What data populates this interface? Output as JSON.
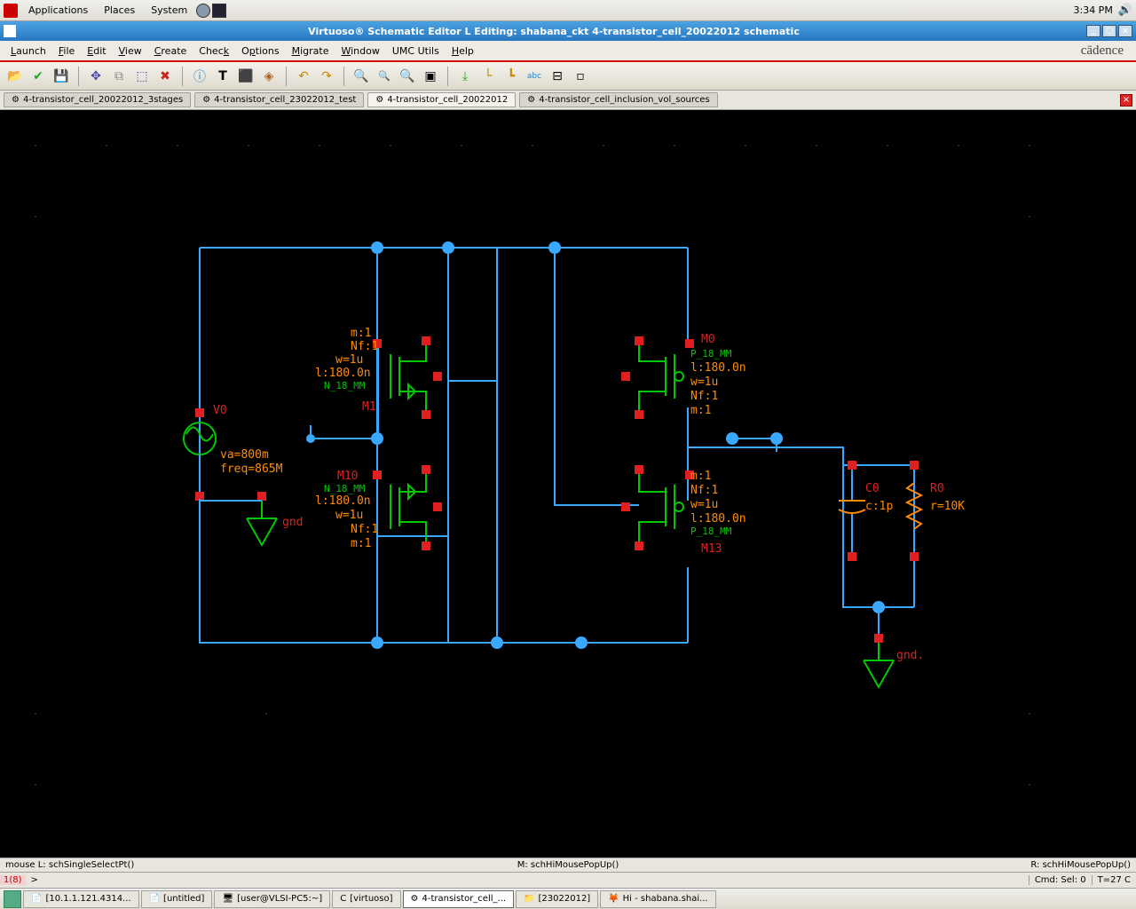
{
  "gnome": {
    "applications": "Applications",
    "places": "Places",
    "system": "System",
    "time": "3:34 PM"
  },
  "window_title": "Virtuoso® Schematic Editor L Editing: shabana_ckt 4-transistor_cell_20022012 schematic",
  "menu": {
    "launch": "Launch",
    "file": "File",
    "edit": "Edit",
    "view": "View",
    "create": "Create",
    "check": "Check",
    "options": "Options",
    "migrate": "Migrate",
    "window": "Window",
    "umc": "UMC Utils",
    "help": "Help"
  },
  "brand": "cādence",
  "tabs": [
    "4-transistor_cell_20022012_3stages",
    "4-transistor_cell_23022012_test",
    "4-transistor_cell_20022012",
    "4-transistor_cell_inclusion_vol_sources"
  ],
  "schematic": {
    "V0": {
      "name": "V0",
      "va": "va=800m",
      "freq": "freq=865M"
    },
    "M1": {
      "name": "M1",
      "m": "m:1",
      "nf": "Nf:1",
      "w": "w=1u",
      "l": "l:180.0n",
      "type": "N_18_MM"
    },
    "M10": {
      "name": "M10",
      "m": "m:1",
      "nf": "Nf:1",
      "w": "w=1u",
      "l": "l:180.0n",
      "type": "N_18_MM"
    },
    "M0": {
      "name": "M0",
      "m": "m:1",
      "nf": "Nf:1",
      "w": "w=1u",
      "l": "l:180.0n",
      "type": "P_18_MM"
    },
    "M13": {
      "name": "M13",
      "m": "m:1",
      "nf": "Nf:1",
      "w": "w=1u",
      "l": "l:180.0n",
      "type": "P_18_MM"
    },
    "C0": {
      "name": "C0",
      "val": "c:1p"
    },
    "R0": {
      "name": "R0",
      "val": "r=10K"
    },
    "gnd": "gnd",
    "gnd2": "gnd."
  },
  "status": {
    "left": "mouse L: schSingleSelectPt()",
    "mid": "M: schHiMousePopUp()",
    "right": "R: schHiMousePopUp()"
  },
  "cmd": {
    "label": "1(8)",
    "prompt": ">",
    "sel": "Cmd: Sel: 0",
    "temp": "T=27  C"
  },
  "tasks": [
    "[10.1.1.121.4314...",
    "[untitled]",
    "[user@VLSI-PC5:~]",
    "[virtuoso]",
    "4-transistor_cell_...",
    "[23022012]",
    "Hi - shabana.shai..."
  ]
}
